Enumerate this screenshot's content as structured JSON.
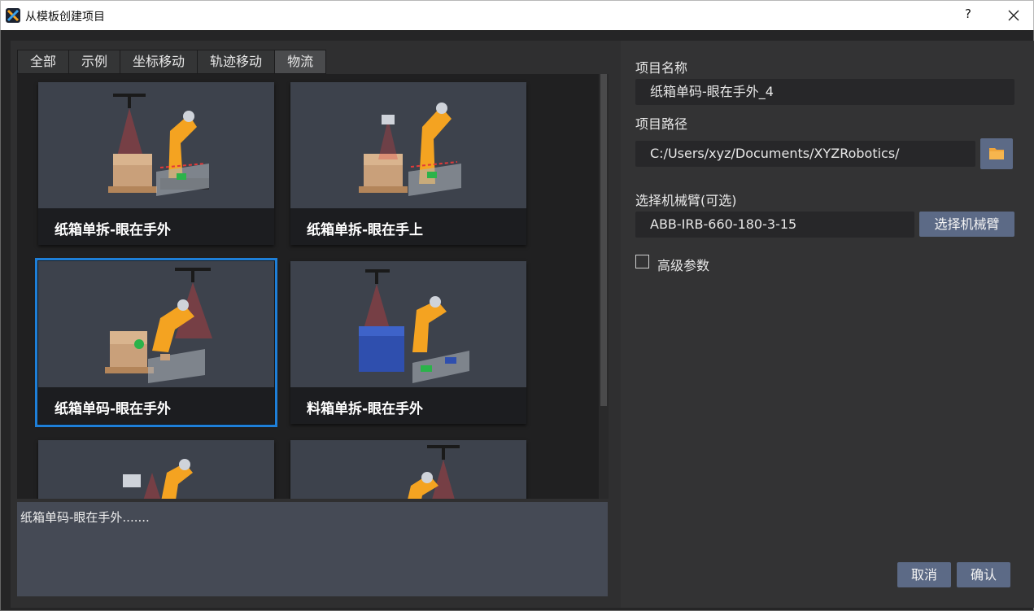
{
  "window": {
    "title": "从模板创建项目",
    "help_label": "?"
  },
  "tabs": [
    {
      "label": "全部"
    },
    {
      "label": "示例"
    },
    {
      "label": "坐标移动"
    },
    {
      "label": "轨迹移动"
    },
    {
      "label": "物流",
      "active": true
    }
  ],
  "templates": [
    {
      "label": "纸箱单拆-眼在手外"
    },
    {
      "label": "纸箱单拆-眼在手上"
    },
    {
      "label": "纸箱单码-眼在手外",
      "selected": true
    },
    {
      "label": "料箱单拆-眼在手外"
    },
    {
      "label": ""
    },
    {
      "label": ""
    }
  ],
  "description": "纸箱单码-眼在手外.......",
  "form": {
    "name_label": "项目名称",
    "name_value": "纸箱单码-眼在手外_4",
    "path_label": "项目路径",
    "path_value": "C:/Users/xyz/Documents/XYZRobotics/",
    "robot_label": "选择机械臂(可选)",
    "robot_value": "ABB-IRB-660-180-3-15",
    "robot_button": "选择机械臂",
    "advanced_label": "高级参数",
    "advanced_checked": false
  },
  "actions": {
    "cancel": "取消",
    "confirm": "确认"
  },
  "colors": {
    "accent": "#1e7fd8",
    "button": "#5c6a86",
    "robot_orange": "#f4a321",
    "scan_red": "#e23a3a",
    "folder": "#f0a53a"
  }
}
